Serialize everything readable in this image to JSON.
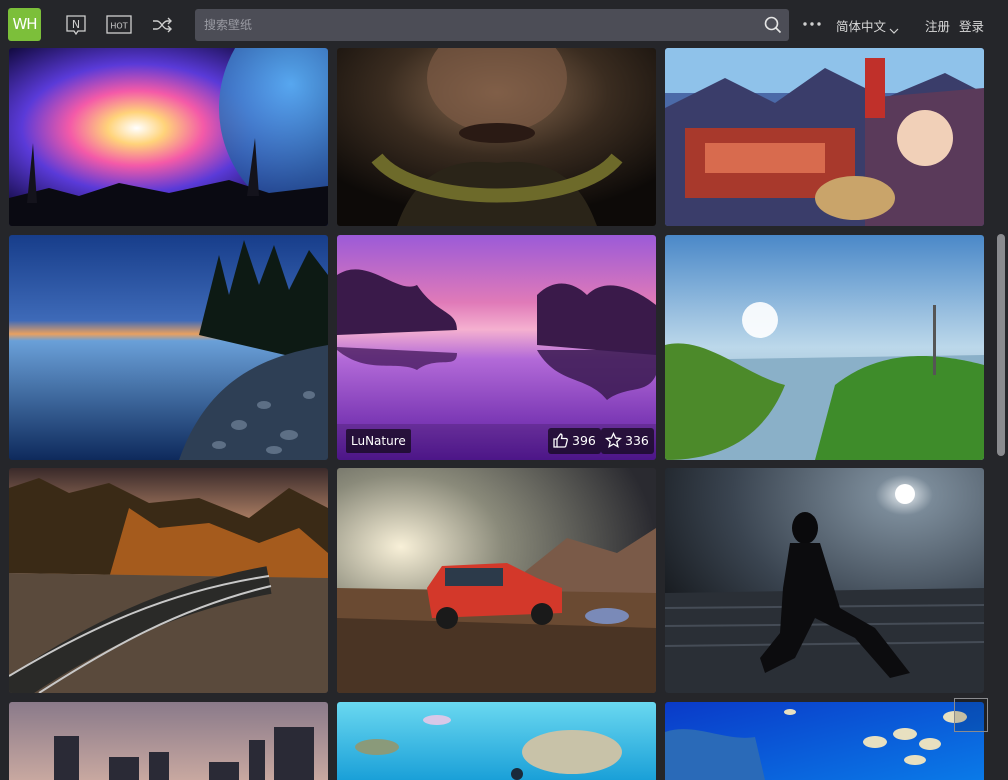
{
  "app": {
    "logo_text": "WH"
  },
  "nav": {
    "new_icon_label": "N",
    "hot_icon_label": "HOT"
  },
  "search": {
    "placeholder": "搜索壁纸"
  },
  "header": {
    "language": "简体中文",
    "register": "注册",
    "login": "登录"
  },
  "colors": {
    "brand": "#7cbf3a",
    "background": "#25262a",
    "search_bg": "#4c4d56"
  },
  "wallpapers": [
    {
      "subject": "cosmic nebula planet"
    },
    {
      "subject": "wukong monkey face"
    },
    {
      "subject": "anime japanese town fox girl"
    },
    {
      "subject": "rocky lake shore dusk"
    },
    {
      "subject": "purple lake reflection",
      "uploader": "LuNature",
      "likes": "396",
      "favorites": "336"
    },
    {
      "subject": "sunny lake marsh"
    },
    {
      "subject": "railway through autumn forest"
    },
    {
      "subject": "red car on rocky road"
    },
    {
      "subject": "catwoman dark moon"
    },
    {
      "subject": "city skyline dusk"
    },
    {
      "subject": "underwater fish and turtle"
    },
    {
      "subject": "coral reef fish school"
    }
  ]
}
